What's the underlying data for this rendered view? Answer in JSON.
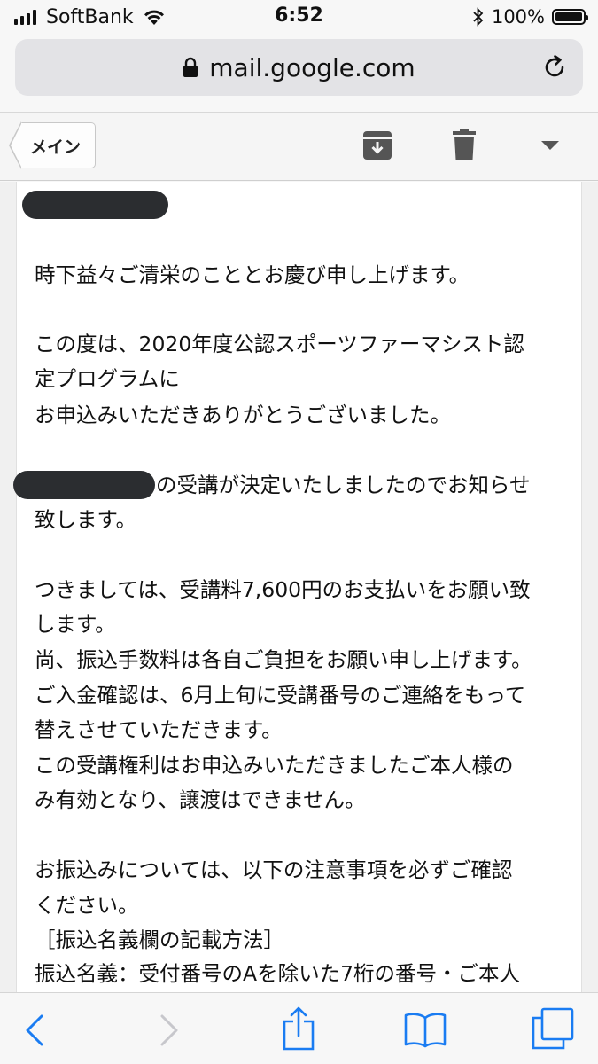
{
  "status_bar": {
    "carrier": "SoftBank",
    "time": "6:52",
    "battery": "100%"
  },
  "browser": {
    "url": "mail.google.com"
  },
  "toolbar": {
    "back_label": "メイン"
  },
  "email": {
    "lines": [
      "時下益々ご清栄のこととお慶び申し上げます。",
      "この度は、2020年度公認スポーツファーマシスト認",
      "定プログラムに",
      "お申込みいただきありがとうございました。",
      "の受講が決定いたしましたのでお知らせ",
      "致します。",
      "つきましては、受講料7,600円のお支払いをお願い致",
      "します。",
      "尚、振込手数料は各自ご負担をお願い申し上げます。",
      "ご入金確認は、6月上旬に受講番号のご連絡をもって",
      "替えさせていただきます。",
      "この受講権利はお申込みいただきましたご本人様の",
      "み有効となり、譲渡はできません。",
      "お振込みについては、以下の注意事項を必ずご確認",
      "ください。",
      "［振込名義欄の記載方法］",
      "振込名義：受付番号のAを除いた7桁の番号・ご本人"
    ]
  },
  "colors": {
    "accent": "#1a7cf2",
    "icon_gray": "#555555",
    "redaction": "#2b2d30"
  },
  "icons": {
    "archive": "archive-icon",
    "trash": "trash-icon",
    "more": "chevron-down-icon",
    "share": "share-icon",
    "bookmarks": "bookmarks-icon",
    "tabs": "tabs-icon"
  }
}
